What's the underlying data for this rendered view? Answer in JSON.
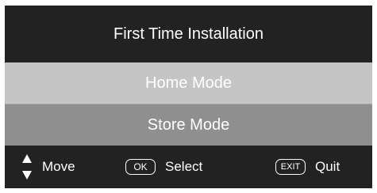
{
  "dialog": {
    "title": "First Time Installation",
    "options": [
      {
        "label": "Home Mode",
        "state": "highlighted"
      },
      {
        "label": "Store Mode",
        "state": "normal"
      }
    ]
  },
  "footer": {
    "move": {
      "icon": "up-down-arrows-icon",
      "label": "Move"
    },
    "select": {
      "key": "OK",
      "icon": "ok-key-icon",
      "label": "Select"
    },
    "quit": {
      "key": "EXIT",
      "icon": "exit-key-icon",
      "label": "Quit"
    }
  },
  "colors": {
    "background": "#222222",
    "highlight": "#c5c5c5",
    "option": "#8f8f8f",
    "text": "#ffffff"
  }
}
